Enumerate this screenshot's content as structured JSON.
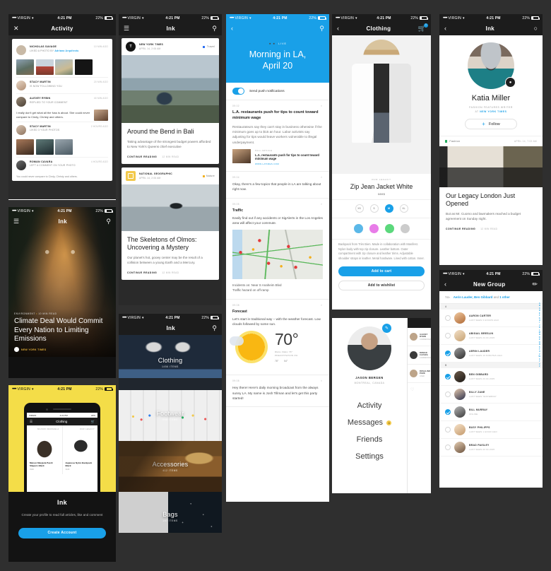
{
  "common": {
    "status": {
      "carrier": "VIRGIN",
      "time": "4:21 PM",
      "battery": "22%",
      "dots": "●●●●●",
      "wifi": "▾"
    },
    "app_name": "Ink",
    "accent": "#19a0e8",
    "yellow": "#f4dd48",
    "dark": "#1c1c1c"
  },
  "activity_screen": {
    "title": "Activity",
    "close_icon": "close-icon",
    "items": [
      {
        "name": "NICHOLAS SAVAGE",
        "action": "LIKED A PHOTO BY",
        "highlight": "Adriano Arquitectu",
        "time": "10 MIN AGO",
        "kind": "photos"
      },
      {
        "name": "STACY MARTIN",
        "action": "IS NOW FOLLOWING YOU",
        "time": "20 MIN AGO",
        "kind": "plain"
      },
      {
        "name": "ALEXEY RYBIN",
        "action": "REPLIED TO YOUR COMMENT",
        "time": "40 MIN AGO",
        "kind": "comment",
        "comment": "I really don't get what all the fuss is about. She could never compare to Cindy, Christy and others."
      },
      {
        "name": "STACY MARTIN",
        "action": "LIKED 3 YOUR PHOTOS",
        "time": "2 HOURS AGO",
        "kind": "photos"
      },
      {
        "name": "ROMAN CAVARA",
        "action": "LEFT A COMMENT ON YOUR PHOTO",
        "time": "4 HOURS AGO",
        "kind": "plain"
      }
    ],
    "footer": "You could never compare to Cindy, Christy and others."
  },
  "climate_screen": {
    "title": "Ink",
    "kicker_tag": "ENVIRONMENT",
    "kicker_read": "10 MIN READ",
    "headline": "Climate Deal Would Commit Every Nation to Limiting Emissions",
    "source": "NEW YORK TIMES",
    "menu_icon": "hamburger-icon",
    "search_icon": "search-icon"
  },
  "signup_screen": {
    "logo": "Ink",
    "copy": "Create your profile to read full articles, like and comment",
    "cta": "Create Account",
    "preview": {
      "nav_title": "Clothing",
      "products": [
        {
          "brand": "MAISON MARGIELA",
          "name": "Maison Margiela Pazzli Slippers Black",
          "price": "390€"
        },
        {
          "brand": "OUR LEGACY",
          "name": "Japanese Nylon Backpack Black",
          "price": "310€"
        }
      ]
    }
  },
  "feed_screen": {
    "title": "Ink",
    "menu_icon": "hamburger-icon",
    "search_icon": "search-icon",
    "cards": [
      {
        "source": "NEW YORK TIMES",
        "date": "APRIL 14, 2:06 AM",
        "tag": "Travel",
        "tag_color": "#2b6ff2",
        "headline": "Around the Bend in Bali",
        "dek": "Taking advantage of the strongest budget powers afforded to New York's Queens chief executive",
        "cta": "CONTINUE READING",
        "readtime": "12 MIN READ"
      },
      {
        "source": "NATIONAL GEOGRAPHIC",
        "date": "APRIL 14, 2:06 AM",
        "tag": "Nature",
        "tag_color": "#f2b01e",
        "headline": "The Skeletons of Olmos: Uncovering a Mystery",
        "dek": "Our planet's hot, gooey center may be the result of a collision between a young Earth and a Mercury.",
        "cta": "CONTINUE READING",
        "readtime": "12 MIN READ"
      }
    ]
  },
  "categories_screen": {
    "title": "Ink",
    "search_icon": "search-icon",
    "items": [
      {
        "label": "Clothing",
        "count": "1456 ITEMS"
      },
      {
        "label": "Footwear",
        "count": "668 ITEMS"
      },
      {
        "label": "Accessories",
        "count": "412 ITEMS"
      },
      {
        "label": "Bags",
        "count": "187 ITEMS"
      }
    ]
  },
  "la_screen": {
    "back_icon": "chevron-left-icon",
    "search_icon": "search-icon",
    "live_label": "LIVE",
    "title": "Morning in LA,\nApril 20",
    "push_toggle_label": "Send push notifications",
    "push_toggle_on": true,
    "blocks": [
      {
        "time": "09:02",
        "headline": "L.A. restaurants push for tips to count toward minimum wage",
        "body": "Restaurateurs say they can't stay in business otherwise if the minimum goes up to $15 an hour. Labor activists say adjusting for tips would leave workers vulnerable to illegal underpayment.",
        "link": {
          "source": "FULL ARTICLE",
          "title": "L.A. restaurants push for tips to count toward minimum wage",
          "url": "WWW.LATIMES.COM"
        }
      },
      {
        "time": "09:04",
        "body": "Okay, there's a few topics that people in LA are talking about right now."
      },
      {
        "time": "09:05",
        "subhead": "Traffic",
        "body": "Easily find out if any accidents or SigAlerts in the Los Angeles area will affect your commute.",
        "map_caption": "Incidents on: Near S Anaheim Blvd\nTraffic hazard on off-ramp"
      },
      {
        "time": "09:08",
        "subhead": "Forecast",
        "body": "Let's start in traditional way – with the weather forecast. Low clouds followed by some sun.",
        "weather": {
          "temp": "70°",
          "real_feel": "REAL FEEL 78°",
          "precip": "PRECIPITATION 0%",
          "high": "78°",
          "low": "54°"
        }
      },
      {
        "time": "09:08",
        "body": "Hey there! Here's daily morning broadcast from the always sunny LA. My name is Josh Tillman and let's get this party started!"
      }
    ]
  },
  "product_screen": {
    "title": "Clothing",
    "back_icon": "chevron-left-icon",
    "cart_icon": "cart-icon",
    "cart_count": "1",
    "brand": "OUR LEGACY",
    "name": "Zip Jean Jacket White",
    "price": "380$",
    "sizes": [
      "XS",
      "S",
      "M",
      "XL"
    ],
    "selected_size": "M",
    "colors": [
      "#5bb8e8",
      "#e87ce8",
      "#5bd87c",
      "#cccccc"
    ],
    "description": "Backpack from Très Bien. Made in collaboration with Manifest. Nylon body with top zip closure. Leather bottom. Outer compartment with zip closure and leather trims. Adjustable shoulder straps in leather. Metal hardware. Lined with cotton. Inner.",
    "add_to_cart": "Add to cart",
    "add_to_wishlist": "Add to wishlist"
  },
  "menu_screen": {
    "user_name": "JASON BERGEN",
    "user_location": "MONTREAL, CANADA",
    "edit_icon": "edit-icon",
    "items": [
      {
        "label": "Activity",
        "badge": null
      },
      {
        "label": "Messages",
        "badge": "3"
      },
      {
        "label": "Friends",
        "badge": null
      },
      {
        "label": "Settings",
        "badge": null
      }
    ],
    "peek": [
      {
        "name": "ALEXEY RYBIN",
        "sub": "COMMENTED"
      },
      {
        "name": "ROMAN CAVARA",
        "sub": "COMMENTED"
      },
      {
        "name": "ROSALIND PARK",
        "sub": "LIKED"
      }
    ]
  },
  "profile_screen": {
    "title": "Ink",
    "back_icon": "chevron-left-icon",
    "message_icon": "message-icon",
    "camera_icon": "camera-icon",
    "name": "Katia Miller",
    "role": "FASHION FEATURES WRITER",
    "at_label": "AT",
    "at_publication": "NEW YORK TIMES",
    "follow_label": "Follow",
    "post": {
      "tag": "Fashion",
      "tag_color": "#27ae60",
      "date": "APRIL 14, 7:02 AM",
      "headline": "Our Legacy London Just Opened",
      "dek": "But as Mr. Cuomo and lawmakers reached a budget agreement on Sunday night.",
      "cta": "CONTINUE READING",
      "readtime": "12 MIN READ"
    }
  },
  "new_group_screen": {
    "title": "New Group",
    "back_icon": "chevron-left-icon",
    "compose_icon": "compose-icon",
    "to_label": "TO:",
    "to_value": "Aerin Lauder, Ben Gibbard",
    "to_and": "and",
    "to_more": "1 other",
    "index": [
      "A",
      "B",
      "C",
      "D",
      "E",
      "F",
      "G",
      "H",
      "I",
      "J",
      "K",
      "L",
      "M",
      "N",
      "O",
      "P",
      "Q",
      "R",
      "S",
      "T",
      "U",
      "V",
      "W",
      "X",
      "Y",
      "Z",
      "#"
    ],
    "sections": [
      {
        "letter": "A",
        "contacts": [
          {
            "name": "AARON CARTER",
            "status": "LAST SEEN 3 HOURS AGO",
            "selected": false
          },
          {
            "name": "ABIGAIL BRESLIN",
            "status": "LAST SEEN 24.04.2015",
            "selected": false
          },
          {
            "name": "AERIN LAUDER",
            "status": "LAST SEEN 10 MINUTES AGO",
            "selected": true
          }
        ]
      },
      {
        "letter": "B",
        "contacts": [
          {
            "name": "BEN GIBBARD",
            "status": "LAST SEEN 23.04.2015",
            "selected": true
          },
          {
            "name": "BILLY ZANE",
            "status": "LAST SEEN YESTERDAY",
            "selected": false
          },
          {
            "name": "BILL MURRAY",
            "status": "ONLINE",
            "selected": true
          },
          {
            "name": "BUSY PHILIPPS",
            "status": "LAST SEEN 1 HOUR AGO",
            "selected": false
          },
          {
            "name": "BRAD PAISLEY",
            "status": "LAST SEEN 22.04.2015",
            "selected": false
          }
        ]
      }
    ]
  }
}
